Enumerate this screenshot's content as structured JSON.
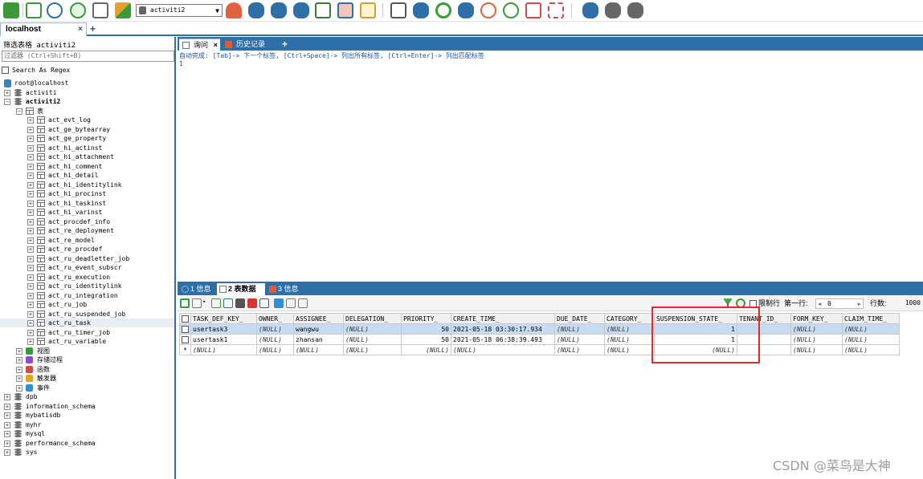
{
  "toolbar": {
    "db_selector": "activiti2",
    "icons": [
      "connect-icon",
      "new-query-icon",
      "run-icon",
      "run-all-icon",
      "run-current-icon",
      "schema-designer-icon",
      "user-manager-icon",
      "db-add-icon",
      "db-copy-icon",
      "db-backup-icon",
      "table-structure-icon",
      "table-data-icon",
      "import-icon",
      "schema-sync-icon",
      "data-sync-icon",
      "refresh-icon",
      "data-transfer-icon",
      "scheduler-icon",
      "restore-icon",
      "query-builder-icon",
      "format-icon",
      "backup-group-icon",
      "compare-icon",
      "sync-settings-icon"
    ]
  },
  "connection_tab": {
    "label": "localhost",
    "close": "×",
    "add": "+"
  },
  "left": {
    "title": "筛选表格 activiti2",
    "filter_placeholder": "过滤器 (Ctrl+Shift+B)",
    "regex_label": "Search As Regex",
    "root": "root@localhost",
    "db1": "activiti",
    "db2": "activiti2",
    "tables_folder": "表",
    "tables": [
      "act_evt_log",
      "act_ge_bytearray",
      "act_ge_property",
      "act_hi_actinst",
      "act_hi_attachment",
      "act_hi_comment",
      "act_hi_detail",
      "act_hi_identitylink",
      "act_hi_procinst",
      "act_hi_taskinst",
      "act_hi_varinst",
      "act_procdef_info",
      "act_re_deployment",
      "act_re_model",
      "act_re_procdef",
      "act_ru_deadletter_job",
      "act_ru_event_subscr",
      "act_ru_execution",
      "act_ru_identitylink",
      "act_ru_integration",
      "act_ru_job",
      "act_ru_suspended_job",
      "act_ru_task",
      "act_ru_timer_job",
      "act_ru_variable"
    ],
    "folders": [
      "视图",
      "存储过程",
      "函数",
      "触发器",
      "事件"
    ],
    "databases": [
      "dpb",
      "information_schema",
      "mybatisdb",
      "myhr",
      "mysql",
      "performance_schema",
      "sys"
    ]
  },
  "query_tabs": {
    "query": "询问",
    "history": "历史记录",
    "add": "+",
    "close": "×"
  },
  "editor": {
    "hint": "自动完成: [Tab]-> 下一个标签, [Ctrl+Space]-> 列出所有标签, [Ctrl+Enter]-> 列出匹配标签",
    "line_number": "1"
  },
  "result_tabs": {
    "info1": "1 信息",
    "data": "2 表数据",
    "info3": "3 信息"
  },
  "grid_toolbar": {
    "limit_label": "限制行",
    "first_row_label": "第一行:",
    "first_row_value": "0",
    "rows_label": "行数:",
    "rows_value": "1000"
  },
  "grid": {
    "columns": [
      "TASK_DEF_KEY_",
      "OWNER_",
      "ASSIGNEE_",
      "DELEGATION_",
      "PRIORITY_",
      "CREATE_TIME_",
      "DUE_DATE_",
      "CATEGORY_",
      "SUSPENSION_STATE_",
      "TENANT_ID_",
      "FORM_KEY_",
      "CLAIM_TIME_"
    ],
    "rows": [
      [
        "usertask3",
        "(NULL)",
        "wangwu",
        "(NULL)",
        "50",
        "2021-05-18 03:30:17.934",
        "(NULL)",
        "(NULL)",
        "1",
        "",
        "(NULL)",
        "(NULL)"
      ],
      [
        "usertask1",
        "(NULL)",
        "zhansan",
        "(NULL)",
        "50",
        "2021-05-18 06:38:39.493",
        "(NULL)",
        "(NULL)",
        "1",
        "",
        "(NULL)",
        "(NULL)"
      ],
      [
        "(NULL)",
        "(NULL)",
        "(NULL)",
        "(NULL)",
        "(NULL)",
        "(NULL)",
        "(NULL)",
        "(NULL)",
        "(NULL)",
        "",
        "(NULL)",
        "(NULL)"
      ]
    ],
    "new_row_marker": "*"
  },
  "watermark": "CSDN @菜鸟是大神",
  "colors": {
    "accent": "#2f6fa7",
    "highlight_box": "#e32b2b",
    "selected_row": "#c6dcf2"
  }
}
